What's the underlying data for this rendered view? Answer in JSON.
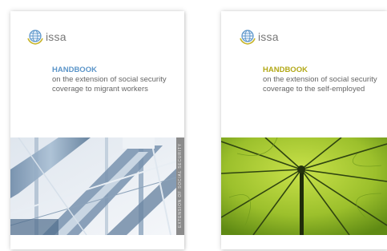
{
  "covers": [
    {
      "logo_text": "issa",
      "handbook_label": "HANDBOOK",
      "subtitle_line1": "on the extension of social security",
      "subtitle_line2": "coverage to migrant workers",
      "accent_color": "#5b95c9",
      "spine_text": "EXTENSION OF SOCIAL SECURITY",
      "image": "industrial-escalator-photo"
    },
    {
      "logo_text": "issa",
      "handbook_label": "HANDBOOK",
      "subtitle_line1": "on the extension of social security",
      "subtitle_line2": "coverage to the self-employed",
      "accent_color": "#b2a817",
      "image": "green-umbrella-photo"
    }
  ]
}
